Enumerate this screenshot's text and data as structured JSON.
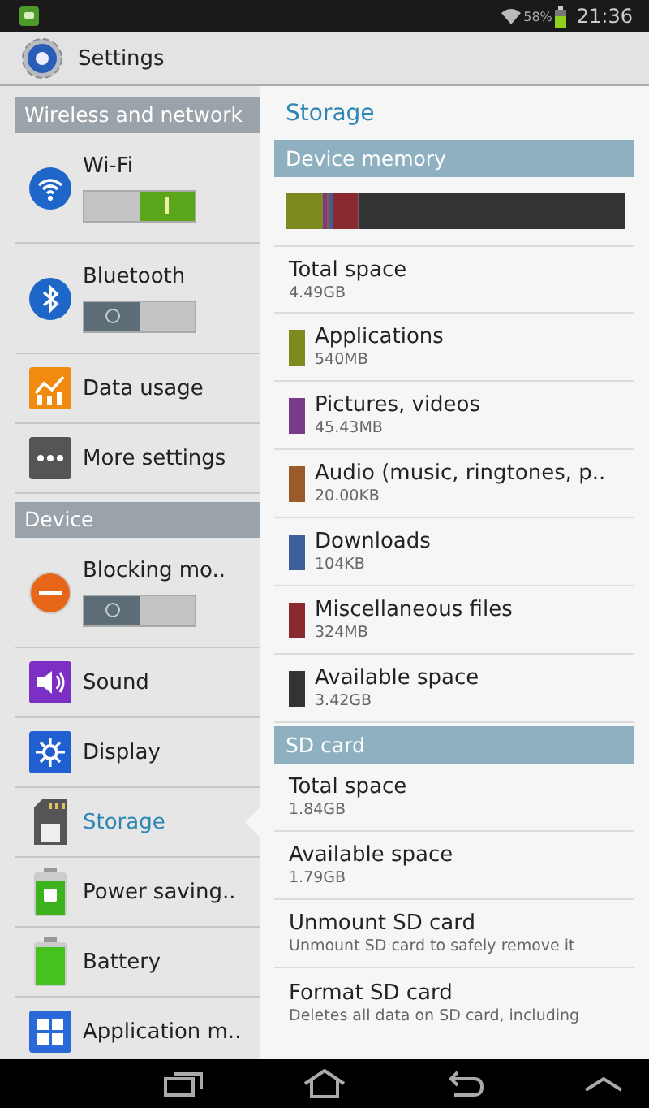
{
  "status_bar": {
    "battery_percent": "58%",
    "time": "21:36"
  },
  "action_bar": {
    "title": "Settings"
  },
  "sidebar": {
    "sections": [
      {
        "title": "Wireless and network",
        "items": [
          {
            "label": "Wi-Fi",
            "kind": "toggle",
            "on": true,
            "selected": false
          },
          {
            "label": "Bluetooth",
            "kind": "toggle",
            "on": false,
            "selected": false
          },
          {
            "label": "Data usage",
            "kind": "link",
            "selected": false
          },
          {
            "label": "More settings",
            "kind": "link",
            "selected": false
          }
        ]
      },
      {
        "title": "Device",
        "items": [
          {
            "label": "Blocking mo..",
            "kind": "toggle",
            "on": false,
            "selected": false
          },
          {
            "label": "Sound",
            "kind": "link",
            "selected": false
          },
          {
            "label": "Display",
            "kind": "link",
            "selected": false
          },
          {
            "label": "Storage",
            "kind": "link",
            "selected": true
          },
          {
            "label": "Power saving..",
            "kind": "link",
            "selected": false
          },
          {
            "label": "Battery",
            "kind": "link",
            "selected": false
          },
          {
            "label": "Application m..",
            "kind": "link",
            "selected": false
          }
        ]
      }
    ]
  },
  "detail": {
    "title": "Storage",
    "sections": [
      {
        "title": "Device memory",
        "items": [
          {
            "label": "Total space",
            "value": "4.49GB"
          },
          {
            "label": "Applications",
            "value": "540MB",
            "color": "#7d8a1e"
          },
          {
            "label": "Pictures, videos",
            "value": "45.43MB",
            "color": "#7a3a8a"
          },
          {
            "label": "Audio (music, ringtones, p..",
            "value": "20.00KB",
            "color": "#9a5a2a"
          },
          {
            "label": "Downloads",
            "value": "104KB",
            "color": "#3e5f9a"
          },
          {
            "label": "Miscellaneous files",
            "value": "324MB",
            "color": "#8a2a2e"
          },
          {
            "label": "Available space",
            "value": "3.42GB",
            "color": "#333333"
          }
        ]
      },
      {
        "title": "SD card",
        "items": [
          {
            "label": "Total space",
            "value": "1.84GB"
          },
          {
            "label": "Available space",
            "value": "1.79GB"
          },
          {
            "label": "Unmount SD card",
            "value": "Unmount SD card to safely remove it"
          },
          {
            "label": "Format SD card",
            "value": "Deletes all data on SD card, including"
          }
        ]
      }
    ]
  }
}
